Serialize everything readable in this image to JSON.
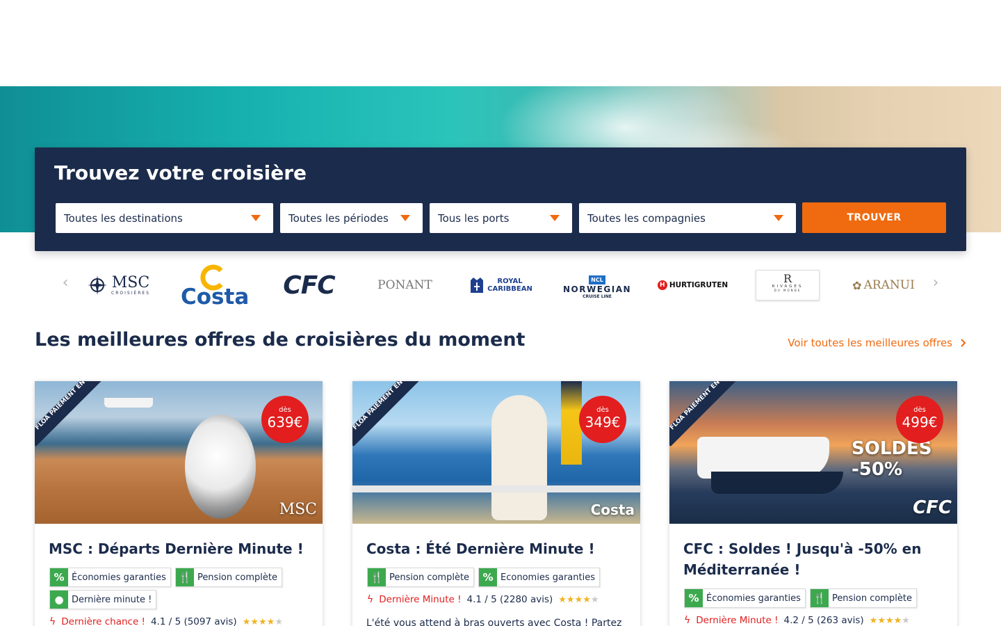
{
  "search": {
    "title": "Trouvez votre croisière",
    "destinations": "Toutes les destinations",
    "periods": "Toutes les périodes",
    "ports": "Tous les ports",
    "companies": "Toutes les compagnies",
    "button": "TROUVER"
  },
  "brands": {
    "prev": "‹",
    "next": "›",
    "items": [
      {
        "name": "MSC",
        "sub": "CROISIÈRES"
      },
      {
        "name": "Costa"
      },
      {
        "name": "CFC"
      },
      {
        "name": "PONANT"
      },
      {
        "name": "ROYAL",
        "sub": "CARIBBEAN"
      },
      {
        "name": "NORWEGIAN",
        "sub": "CRUISE LINE",
        "badge": "NCL"
      },
      {
        "name": "HURTIGRUTEN"
      },
      {
        "name": "RIVAGES",
        "sub": "DU MONDE"
      },
      {
        "name": "ARANUI"
      }
    ]
  },
  "offers": {
    "title": "Les meilleures offres de croisières du moment",
    "see_all": "Voir toutes les meilleures offres",
    "cards": [
      {
        "floa": "FLOA PAIEMENT EN 4X",
        "price_prefix": "dès",
        "price": "639€",
        "image_logo": "MSC",
        "title": "MSC : Départs Dernière Minute !",
        "tags": [
          "Économies garanties",
          "Pension complète",
          "Dernière minute !"
        ],
        "urgency": "Dernière chance !",
        "rating": "4.1 / 5 (5097 avis)"
      },
      {
        "floa": "FLOA PAIEMENT EN 4X",
        "price_prefix": "dès",
        "price": "349€",
        "image_logo": "Costa",
        "title": "Costa : Été Dernière Minute !",
        "tags": [
          "Pension complète",
          "Economies garanties"
        ],
        "urgency": "Dernière Minute !",
        "rating": "4.1 / 5 (2280 avis)",
        "description": "L'été vous attend à bras ouverts avec Costa ! Partez"
      },
      {
        "floa": "FLOA PAIEMENT EN 4X",
        "price_prefix": "dès",
        "price": "499€",
        "image_logo": "CFC",
        "image_promo": "SOLDES -50%",
        "title": "CFC : Soldes ! Jusqu'à -50% en Méditerranée !",
        "tags": [
          "Économies garanties",
          "Pension complète"
        ],
        "urgency": "Dernière Minute !",
        "rating": "4.2 / 5 (263 avis)"
      }
    ]
  },
  "colors": {
    "navy": "#1b2b4b",
    "orange": "#f06a0f",
    "red": "#e21e1e",
    "green": "#3ca94f"
  }
}
